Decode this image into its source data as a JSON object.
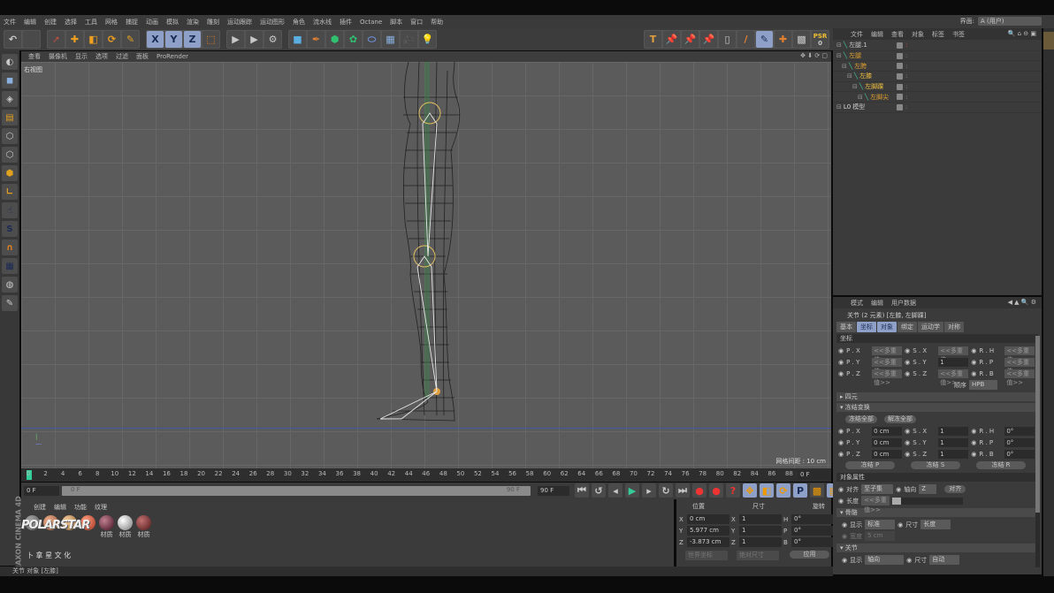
{
  "menu": [
    "文件",
    "编辑",
    "创建",
    "选择",
    "工具",
    "网格",
    "捕捉",
    "动画",
    "模拟",
    "渲染",
    "雕刻",
    "运动跟踪",
    "运动图形",
    "角色",
    "流水线",
    "插件",
    "Octane",
    "脚本",
    "窗口",
    "帮助"
  ],
  "layout": {
    "label": "界面:",
    "value": "A (用户)"
  },
  "psr": {
    "label": "PSR",
    "value": "0"
  },
  "viewport": {
    "menu": [
      "查看",
      "摄像机",
      "显示",
      "选项",
      "过滤",
      "面板",
      "ProRender"
    ],
    "label": "右视图",
    "grid_info": "网格间距 : 10 cm"
  },
  "timeline": {
    "ticks": [
      0,
      2,
      4,
      6,
      8,
      10,
      12,
      14,
      16,
      18,
      20,
      22,
      24,
      26,
      28,
      30,
      32,
      34,
      36,
      38,
      40,
      42,
      44,
      46,
      48,
      50,
      52,
      54,
      56,
      58,
      60,
      62,
      64,
      66,
      68,
      70,
      72,
      74,
      76,
      78,
      80,
      82,
      84,
      86,
      88,
      90
    ],
    "current": "0 F",
    "start": "0 F",
    "range_start": "0 F",
    "range_end": "90 F",
    "end": "90 F",
    "frame_field": "0 F"
  },
  "materials": {
    "menu": [
      "创建",
      "编辑",
      "功能",
      "纹理"
    ],
    "items": [
      "材质",
      "材质",
      "材质"
    ],
    "logo": "POLARSTAR",
    "logo_sub": "卜 拿 星 文 化",
    "brand": "MAXON CINEMA 4D"
  },
  "coords": {
    "headers": [
      "位置",
      "尺寸",
      "旋转"
    ],
    "rows": [
      [
        "X",
        "0 cm",
        "X",
        "1",
        "H",
        "0°"
      ],
      [
        "Y",
        "5.977 cm",
        "Y",
        "1",
        "P",
        "0°"
      ],
      [
        "Z",
        "-3.873 cm",
        "Z",
        "1",
        "B",
        "0°"
      ]
    ],
    "mode1": "世界坐标",
    "mode2": "绝对尺寸",
    "apply": "应用"
  },
  "status": "关节 对象 [左膝]",
  "objects": {
    "menu": [
      "文件",
      "编辑",
      "查看",
      "对象",
      "标签",
      "书签"
    ],
    "items": [
      {
        "name": "左腿.1",
        "color": "#c8c8c8",
        "depth": 0
      },
      {
        "name": "左腿",
        "color": "#e0a030",
        "depth": 0
      },
      {
        "name": "左胯",
        "color": "#e0a030",
        "depth": 1
      },
      {
        "name": "左膝",
        "color": "#f0c040",
        "depth": 2
      },
      {
        "name": "左脚踝",
        "color": "#f0c040",
        "depth": 3
      },
      {
        "name": "左脚尖",
        "color": "#e0a030",
        "depth": 4
      },
      {
        "name": "模型",
        "color": "#c8c8c8",
        "depth": 0
      }
    ]
  },
  "attributes": {
    "menu": [
      "模式",
      "编辑",
      "用户数据"
    ],
    "title": "关节 (2 元素) [左膝, 左脚踝]",
    "tabs": [
      "基本",
      "坐标",
      "对象",
      "绑定",
      "运动学",
      "对称"
    ],
    "coord_section": "坐标",
    "coord_rows": [
      [
        "P . X",
        "<<多重值>>",
        "S . X",
        "<<多重值>>",
        "R . H",
        "<<多重值>>"
      ],
      [
        "P . Y",
        "<<多重值>>",
        "S . Y",
        "1",
        "R . P",
        "<<多重值>>"
      ],
      [
        "P . Z",
        "<<多重值>>",
        "S . Z",
        "<<多重值>>",
        "R . B",
        "<<多重值>>"
      ]
    ],
    "order_label": "顺序",
    "order_value": "HPB",
    "quaternion": "四元",
    "freeze": "冻结变换",
    "freeze_all": "冻结全部",
    "unfreeze_all": "解冻全部",
    "frozen_rows": [
      [
        "P . X",
        "0 cm",
        "S . X",
        "1",
        "R . H",
        "0°"
      ],
      [
        "P . Y",
        "0 cm",
        "S . Y",
        "1",
        "R . P",
        "0°"
      ],
      [
        "P . Z",
        "0 cm",
        "S . Z",
        "1",
        "R . B",
        "0°"
      ]
    ],
    "freeze_p": "冻结 P",
    "freeze_s": "冻结 S",
    "freeze_r": "冻结 R",
    "obj_props": "对象属性",
    "align_label": "对齐",
    "align_value": "至子集",
    "axis_label": "轴向",
    "axis_value": "Z",
    "align_btn": "对齐",
    "length_label": "长度",
    "length_value": "<<多重值>>",
    "bone_section": "骨骼",
    "display_label": "显示",
    "display_value": "标准",
    "size_label": "尺寸",
    "size_value": "长度",
    "width_label": "宽度",
    "width_value": "5 cm",
    "joint_section": "关节",
    "joint_display": "轴向",
    "joint_size": "自动"
  }
}
